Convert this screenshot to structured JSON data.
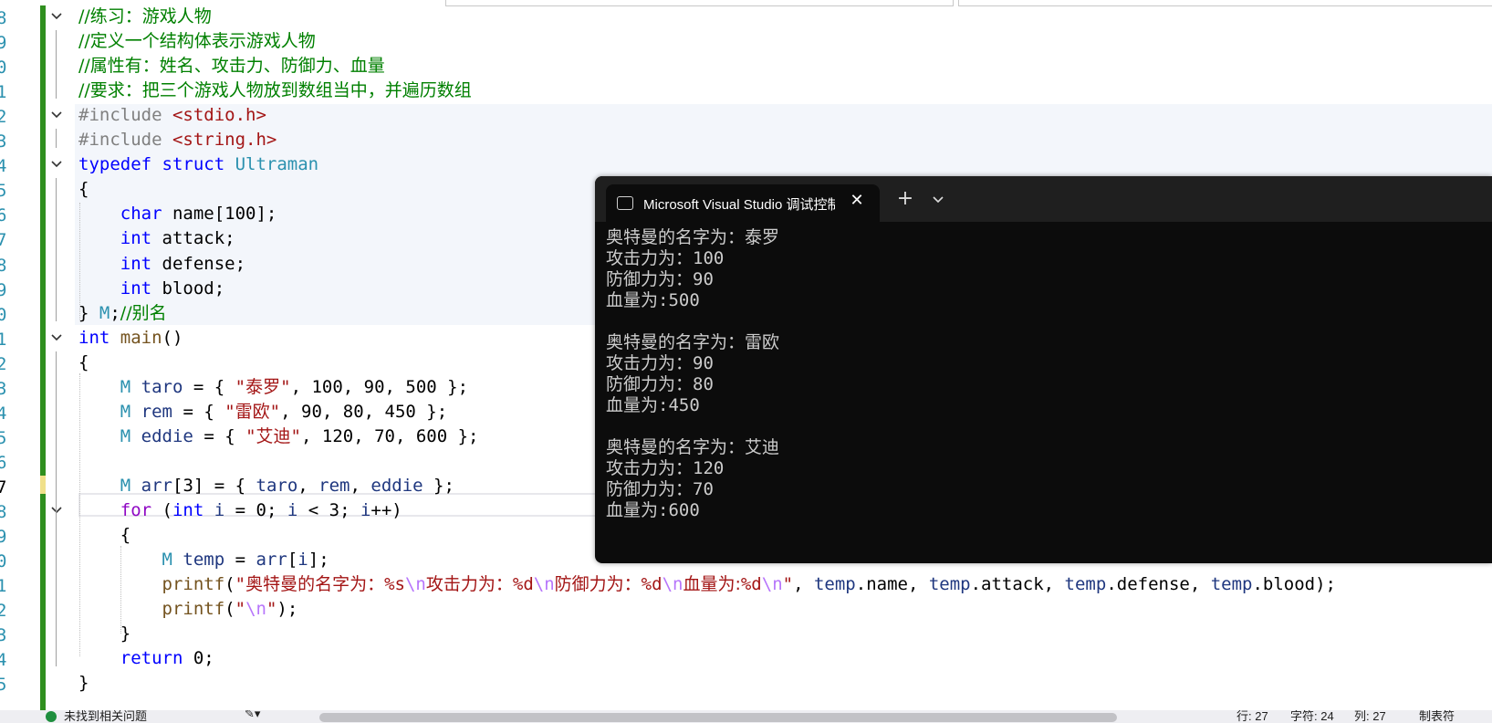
{
  "editor": {
    "line_numbers": [
      "8",
      "9",
      "0",
      "1",
      "2",
      "3",
      "4",
      "5",
      "6",
      "7",
      "8",
      "9",
      "0",
      "1",
      "2",
      "3",
      "4",
      "5",
      "6",
      "7",
      "8",
      "9",
      "0",
      "1",
      "2",
      "3",
      "4",
      "5"
    ],
    "current_line_index": 19,
    "lines": [
      {
        "segments": [
          {
            "c": "cmt",
            "t": "//练习：游戏人物"
          }
        ]
      },
      {
        "segments": [
          {
            "c": "cmt",
            "t": "//定义一个结构体表示游戏人物"
          }
        ]
      },
      {
        "segments": [
          {
            "c": "cmt",
            "t": "//属性有：姓名、攻击力、防御力、血量"
          }
        ]
      },
      {
        "segments": [
          {
            "c": "cmt",
            "t": "//要求：把三个游戏人物放到数组当中，并遍历数组"
          }
        ]
      },
      {
        "segments": [
          {
            "c": "pp",
            "t": "#include "
          },
          {
            "c": "inc",
            "t": "<stdio.h>"
          }
        ]
      },
      {
        "segments": [
          {
            "c": "pp",
            "t": "#include "
          },
          {
            "c": "inc",
            "t": "<string.h>"
          }
        ]
      },
      {
        "segments": [
          {
            "c": "kw",
            "t": "typedef struct "
          },
          {
            "c": "ty",
            "t": "Ultraman"
          }
        ]
      },
      {
        "segments": [
          {
            "c": "",
            "t": "{"
          }
        ]
      },
      {
        "segments": [
          {
            "c": "",
            "t": "    "
          },
          {
            "c": "kw",
            "t": "char"
          },
          {
            "c": "",
            "t": " name[100];"
          }
        ]
      },
      {
        "segments": [
          {
            "c": "",
            "t": "    "
          },
          {
            "c": "kw",
            "t": "int"
          },
          {
            "c": "",
            "t": " attack;"
          }
        ]
      },
      {
        "segments": [
          {
            "c": "",
            "t": "    "
          },
          {
            "c": "kw",
            "t": "int"
          },
          {
            "c": "",
            "t": " defense;"
          }
        ]
      },
      {
        "segments": [
          {
            "c": "",
            "t": "    "
          },
          {
            "c": "kw",
            "t": "int"
          },
          {
            "c": "",
            "t": " blood;"
          }
        ]
      },
      {
        "segments": [
          {
            "c": "",
            "t": "} "
          },
          {
            "c": "ty",
            "t": "M"
          },
          {
            "c": "",
            "t": ";"
          },
          {
            "c": "cmt",
            "t": "//别名"
          }
        ]
      },
      {
        "segments": [
          {
            "c": "kw",
            "t": "int"
          },
          {
            "c": "",
            "t": " "
          },
          {
            "c": "fn",
            "t": "main"
          },
          {
            "c": "",
            "t": "()"
          }
        ]
      },
      {
        "segments": [
          {
            "c": "",
            "t": "{"
          }
        ]
      },
      {
        "segments": [
          {
            "c": "",
            "t": "    "
          },
          {
            "c": "ty",
            "t": "M"
          },
          {
            "c": "",
            "t": " "
          },
          {
            "c": "var",
            "t": "taro"
          },
          {
            "c": "",
            "t": " = { "
          },
          {
            "c": "str",
            "t": "\""
          },
          {
            "c": "strcn",
            "t": "泰罗"
          },
          {
            "c": "str",
            "t": "\""
          },
          {
            "c": "",
            "t": ", 100, 90, 500 };"
          }
        ]
      },
      {
        "segments": [
          {
            "c": "",
            "t": "    "
          },
          {
            "c": "ty",
            "t": "M"
          },
          {
            "c": "",
            "t": " "
          },
          {
            "c": "var",
            "t": "rem"
          },
          {
            "c": "",
            "t": " = { "
          },
          {
            "c": "str",
            "t": "\""
          },
          {
            "c": "strcn",
            "t": "雷欧"
          },
          {
            "c": "str",
            "t": "\""
          },
          {
            "c": "",
            "t": ", 90, 80, 450 };"
          }
        ]
      },
      {
        "segments": [
          {
            "c": "",
            "t": "    "
          },
          {
            "c": "ty",
            "t": "M"
          },
          {
            "c": "",
            "t": " "
          },
          {
            "c": "var",
            "t": "eddie"
          },
          {
            "c": "",
            "t": " = { "
          },
          {
            "c": "str",
            "t": "\""
          },
          {
            "c": "strcn",
            "t": "艾迪"
          },
          {
            "c": "str",
            "t": "\""
          },
          {
            "c": "",
            "t": ", 120, 70, 600 };"
          }
        ]
      },
      {
        "segments": [
          {
            "c": "",
            "t": ""
          }
        ]
      },
      {
        "segments": [
          {
            "c": "",
            "t": "    "
          },
          {
            "c": "ty",
            "t": "M"
          },
          {
            "c": "",
            "t": " "
          },
          {
            "c": "var",
            "t": "arr"
          },
          {
            "c": "",
            "t": "[3] = { "
          },
          {
            "c": "var",
            "t": "taro"
          },
          {
            "c": "",
            "t": ", "
          },
          {
            "c": "var",
            "t": "rem"
          },
          {
            "c": "",
            "t": ", "
          },
          {
            "c": "var",
            "t": "eddie"
          },
          {
            "c": "",
            "t": " };"
          }
        ]
      },
      {
        "segments": [
          {
            "c": "",
            "t": "    "
          },
          {
            "c": "cs",
            "t": "for"
          },
          {
            "c": "",
            "t": " ("
          },
          {
            "c": "kw",
            "t": "int"
          },
          {
            "c": "",
            "t": " "
          },
          {
            "c": "var",
            "t": "i"
          },
          {
            "c": "",
            "t": " = 0; "
          },
          {
            "c": "var",
            "t": "i"
          },
          {
            "c": "",
            "t": " < 3; "
          },
          {
            "c": "var",
            "t": "i"
          },
          {
            "c": "",
            "t": "++)"
          }
        ]
      },
      {
        "segments": [
          {
            "c": "",
            "t": "    {"
          }
        ]
      },
      {
        "segments": [
          {
            "c": "",
            "t": "        "
          },
          {
            "c": "ty",
            "t": "M"
          },
          {
            "c": "",
            "t": " "
          },
          {
            "c": "var",
            "t": "temp"
          },
          {
            "c": "",
            "t": " = "
          },
          {
            "c": "var",
            "t": "arr"
          },
          {
            "c": "",
            "t": "["
          },
          {
            "c": "var",
            "t": "i"
          },
          {
            "c": "",
            "t": "];"
          }
        ]
      },
      {
        "segments": [
          {
            "c": "",
            "t": "        "
          },
          {
            "c": "fn",
            "t": "printf"
          },
          {
            "c": "",
            "t": "("
          },
          {
            "c": "str",
            "t": "\""
          },
          {
            "c": "strcn",
            "t": "奥特曼的名字为："
          },
          {
            "c": "fmt",
            "t": "%s"
          },
          {
            "c": "esc",
            "t": "\\n"
          },
          {
            "c": "strcn",
            "t": "攻击力为："
          },
          {
            "c": "fmt",
            "t": "%d"
          },
          {
            "c": "esc",
            "t": "\\n"
          },
          {
            "c": "strcn",
            "t": "防御力为："
          },
          {
            "c": "fmt",
            "t": "%d"
          },
          {
            "c": "esc",
            "t": "\\n"
          },
          {
            "c": "strcn",
            "t": "血量为:"
          },
          {
            "c": "fmt",
            "t": "%d"
          },
          {
            "c": "esc",
            "t": "\\n"
          },
          {
            "c": "str",
            "t": "\""
          },
          {
            "c": "",
            "t": ", "
          },
          {
            "c": "var",
            "t": "temp"
          },
          {
            "c": "",
            "t": ".name, "
          },
          {
            "c": "var",
            "t": "temp"
          },
          {
            "c": "",
            "t": ".attack, "
          },
          {
            "c": "var",
            "t": "temp"
          },
          {
            "c": "",
            "t": ".defense, "
          },
          {
            "c": "var",
            "t": "temp"
          },
          {
            "c": "",
            "t": ".blood);"
          }
        ]
      },
      {
        "segments": [
          {
            "c": "",
            "t": "        "
          },
          {
            "c": "fn",
            "t": "printf"
          },
          {
            "c": "",
            "t": "("
          },
          {
            "c": "str",
            "t": "\""
          },
          {
            "c": "esc",
            "t": "\\n"
          },
          {
            "c": "str",
            "t": "\""
          },
          {
            "c": "",
            "t": ");"
          }
        ]
      },
      {
        "segments": [
          {
            "c": "",
            "t": "    }"
          }
        ]
      },
      {
        "segments": [
          {
            "c": "",
            "t": "    "
          },
          {
            "c": "kw",
            "t": "return"
          },
          {
            "c": "",
            "t": " 0;"
          }
        ]
      },
      {
        "segments": [
          {
            "c": "",
            "t": "}"
          }
        ]
      }
    ]
  },
  "terminal": {
    "tab_title": "Microsoft Visual Studio 调试控制台",
    "close_glyph": "✕",
    "new_tab_glyph": "+",
    "output": [
      "奥特曼的名字为：泰罗",
      "攻击力为：100",
      "防御力为：90",
      "血量为:500",
      "",
      "奥特曼的名字为：雷欧",
      "攻击力为：90",
      "防御力为：80",
      "血量为:450",
      "",
      "奥特曼的名字为：艾迪",
      "攻击力为：120",
      "防御力为：70",
      "血量为:600"
    ]
  },
  "statusbar": {
    "issues_text": "未找到相关问题",
    "line": "行: 27",
    "char": "字符: 24",
    "col": "列: 27",
    "tabs": "制表符"
  },
  "colors": {
    "change_bar": "#2f8f1e",
    "terminal_bg": "#0c0c0c",
    "comment": "#008000",
    "keyword": "#0000ff",
    "string": "#a31515"
  }
}
